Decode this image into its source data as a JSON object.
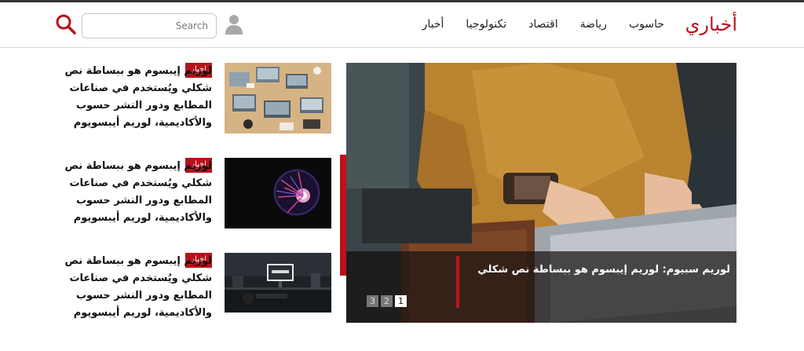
{
  "header": {
    "logo": "أخباري",
    "nav": [
      "أخبار",
      "تكنولوجيا",
      "اقتصاد",
      "رياضة",
      "حاسوب"
    ],
    "search_placeholder": "Search"
  },
  "side_articles": [
    {
      "tag": "اخبار",
      "text": "لوريم إيبسوم هو ببساطة نص شكلي ويُستخدم في صناعات المطابع ودور النشر حسوب والأكاديمية، لوريم أيبسويوم"
    },
    {
      "tag": "اخبار",
      "text": "لوريم إيبسوم هو ببساطة نص شكلي ويُستخدم في صناعات المطابع ودور النشر حسوب والأكاديمية، لوريم أيبسويوم"
    },
    {
      "tag": "اخبار",
      "text": "لوريم إيبسوم هو ببساطة نص شكلي ويُستخدم في صناعات المطابع ودور النشر حسوب والأكاديمية، لوريم أيبسويوم"
    }
  ],
  "slider": {
    "caption": "لوريم سبيوم: لوريم إيبسوم هو ببساطة نص شكلي",
    "pages": [
      "3",
      "2",
      "1"
    ],
    "active_page": "1"
  },
  "colors": {
    "accent": "#b5121b",
    "logo": "#b5121b"
  },
  "icons": {
    "search": "search-icon",
    "user": "user-icon"
  }
}
